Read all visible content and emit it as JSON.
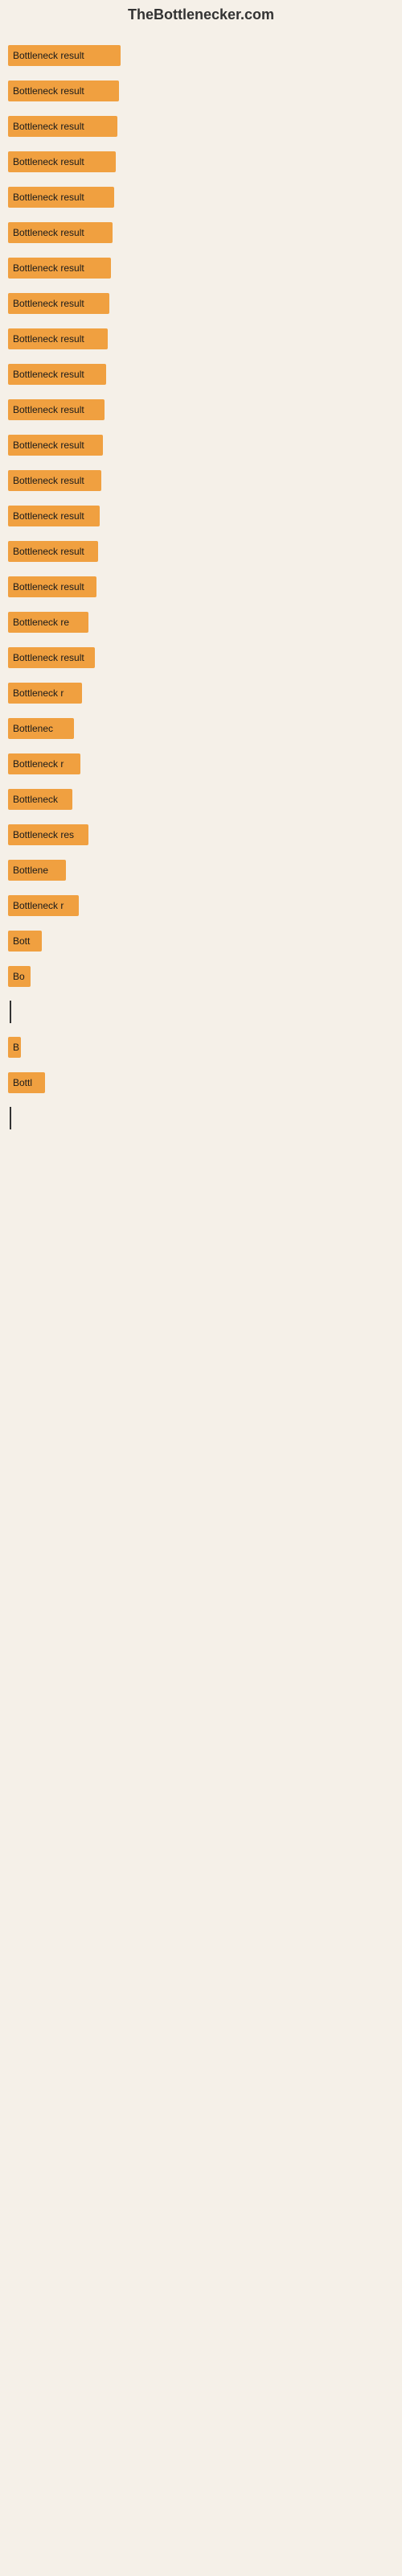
{
  "site": {
    "title": "TheBottlenecker.com"
  },
  "bars": [
    {
      "label": "Bottleneck result",
      "width": 140,
      "truncated": false
    },
    {
      "label": "Bottleneck result",
      "width": 138,
      "truncated": false
    },
    {
      "label": "Bottleneck result",
      "width": 136,
      "truncated": false
    },
    {
      "label": "Bottleneck result",
      "width": 134,
      "truncated": false
    },
    {
      "label": "Bottleneck result",
      "width": 132,
      "truncated": false
    },
    {
      "label": "Bottleneck result",
      "width": 130,
      "truncated": false
    },
    {
      "label": "Bottleneck result",
      "width": 128,
      "truncated": false
    },
    {
      "label": "Bottleneck result",
      "width": 126,
      "truncated": false
    },
    {
      "label": "Bottleneck result",
      "width": 124,
      "truncated": false
    },
    {
      "label": "Bottleneck result",
      "width": 122,
      "truncated": false
    },
    {
      "label": "Bottleneck result",
      "width": 120,
      "truncated": false
    },
    {
      "label": "Bottleneck result",
      "width": 118,
      "truncated": false
    },
    {
      "label": "Bottleneck result",
      "width": 116,
      "truncated": false
    },
    {
      "label": "Bottleneck result",
      "width": 114,
      "truncated": false
    },
    {
      "label": "Bottleneck result",
      "width": 112,
      "truncated": false
    },
    {
      "label": "Bottleneck result",
      "width": 110,
      "truncated": false
    },
    {
      "label": "Bottleneck re",
      "width": 100,
      "truncated": true
    },
    {
      "label": "Bottleneck result",
      "width": 108,
      "truncated": false
    },
    {
      "label": "Bottleneck r",
      "width": 92,
      "truncated": true
    },
    {
      "label": "Bottlenec",
      "width": 82,
      "truncated": true
    },
    {
      "label": "Bottleneck r",
      "width": 90,
      "truncated": true
    },
    {
      "label": "Bottleneck",
      "width": 80,
      "truncated": true
    },
    {
      "label": "Bottleneck res",
      "width": 100,
      "truncated": true
    },
    {
      "label": "Bottlene",
      "width": 72,
      "truncated": true
    },
    {
      "label": "Bottleneck r",
      "width": 88,
      "truncated": true
    },
    {
      "label": "Bott",
      "width": 42,
      "truncated": true
    },
    {
      "label": "Bo",
      "width": 28,
      "truncated": true
    },
    {
      "label": "",
      "width": 8,
      "isLine": true
    },
    {
      "label": "B",
      "width": 16,
      "truncated": true
    },
    {
      "label": "Bottl",
      "width": 46,
      "truncated": true
    },
    {
      "label": "",
      "width": 4,
      "isLine": true
    },
    {
      "label": "",
      "width": 0,
      "empty": true
    },
    {
      "label": "",
      "width": 0,
      "empty": true
    },
    {
      "label": "",
      "width": 0,
      "empty": true
    },
    {
      "label": "",
      "width": 0,
      "empty": true
    },
    {
      "label": "",
      "width": 0,
      "empty": true
    },
    {
      "label": "",
      "width": 0,
      "empty": true
    },
    {
      "label": "",
      "width": 0,
      "empty": true
    },
    {
      "label": "",
      "width": 0,
      "empty": true
    }
  ]
}
